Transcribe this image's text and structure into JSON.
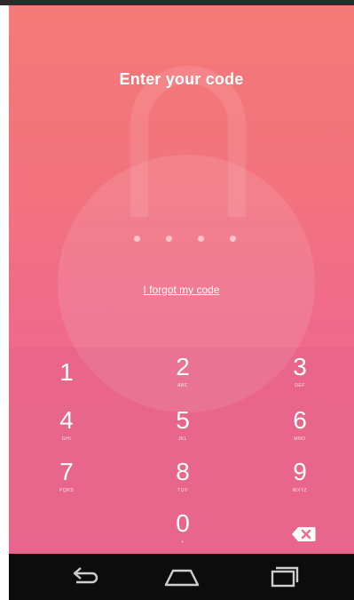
{
  "screen": {
    "title": "Enter your code",
    "forgot_link": "I forgot my code",
    "pin_dots": 4
  },
  "keypad": {
    "keys": [
      {
        "digit": "1",
        "letters": ""
      },
      {
        "digit": "2",
        "letters": "ABC"
      },
      {
        "digit": "3",
        "letters": "DEF"
      },
      {
        "digit": "4",
        "letters": "GHI"
      },
      {
        "digit": "5",
        "letters": "JKL"
      },
      {
        "digit": "6",
        "letters": "MNO"
      },
      {
        "digit": "7",
        "letters": "PQRS"
      },
      {
        "digit": "8",
        "letters": "TUV"
      },
      {
        "digit": "9",
        "letters": "WXYZ"
      },
      {
        "digit": "0",
        "letters": "+"
      }
    ],
    "backspace_icon": "backspace-icon"
  },
  "navbar": {
    "icons": [
      "back-icon",
      "home-icon",
      "recents-icon"
    ]
  },
  "colors": {
    "gradient_top": "#f47a78",
    "gradient_bottom": "#ee6a90",
    "navbar": "#0c0c0c"
  }
}
